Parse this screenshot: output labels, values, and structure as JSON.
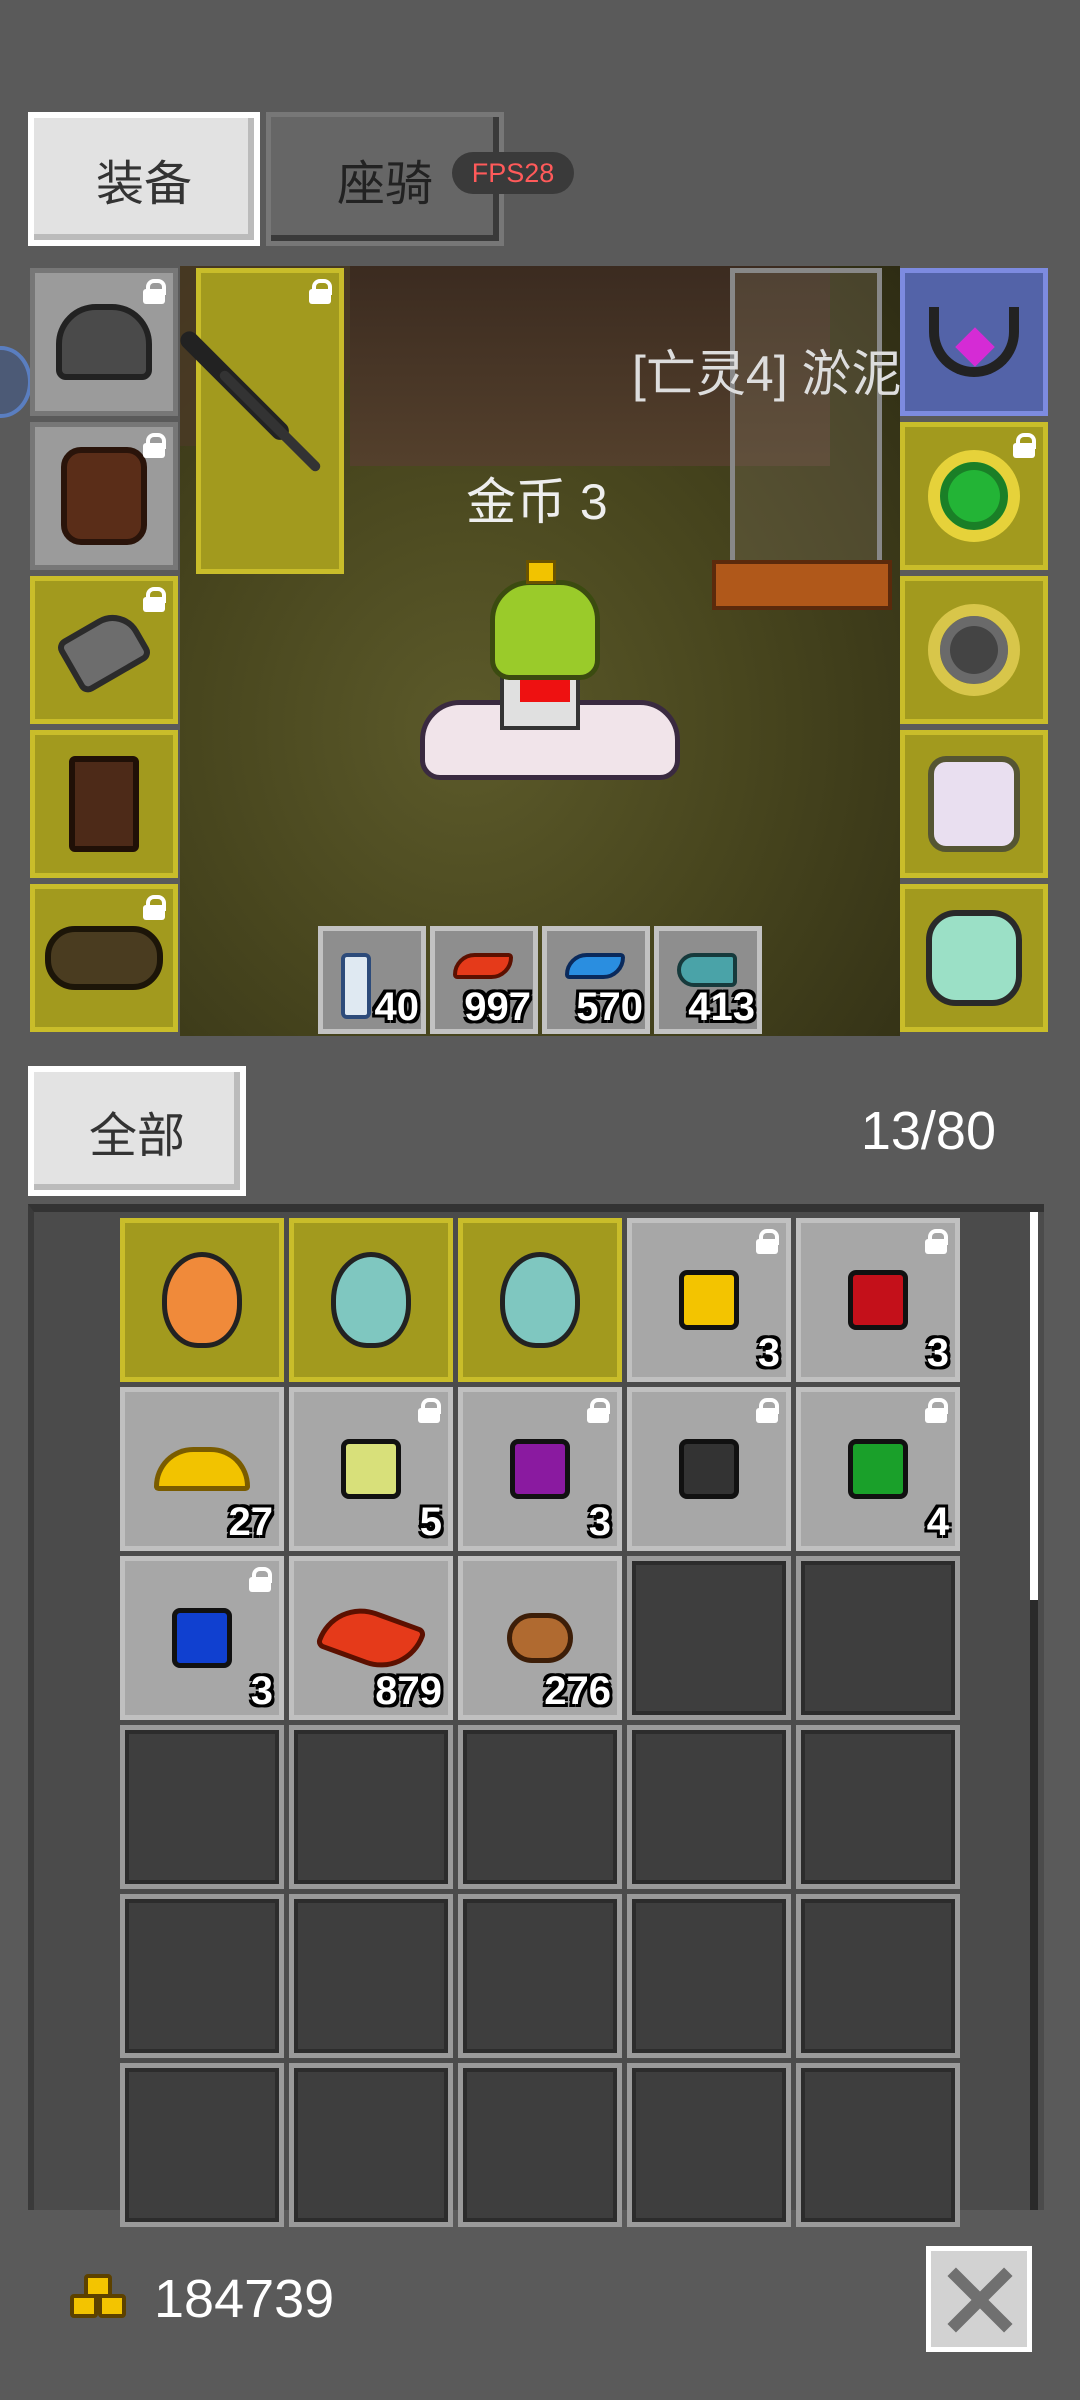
{
  "tabs": {
    "equipment": "装备",
    "mount": "座骑"
  },
  "fps": "FPS28",
  "scene": {
    "gold_text": "金币 3",
    "npc_name": "[亡灵4] 淤泥"
  },
  "equipment_slots": [
    {
      "name": "helmet",
      "locked": true
    },
    {
      "name": "armor",
      "locked": true
    },
    {
      "name": "gloves",
      "locked": true
    },
    {
      "name": "boots",
      "locked": false
    },
    {
      "name": "belt",
      "locked": true
    },
    {
      "name": "spear",
      "locked": true
    },
    {
      "name": "necklace",
      "locked": false
    },
    {
      "name": "green-ring",
      "locked": true
    },
    {
      "name": "black-ring",
      "locked": false
    },
    {
      "name": "unicorn-pet",
      "locked": false
    },
    {
      "name": "green-pet",
      "locked": false
    }
  ],
  "quickbar": [
    {
      "icon": "scroll-icon",
      "count": "40"
    },
    {
      "icon": "red-feather-icon",
      "count": "997"
    },
    {
      "icon": "blue-feather-icon",
      "count": "570"
    },
    {
      "icon": "fish-icon",
      "count": "413"
    }
  ],
  "filter_label": "全部",
  "capacity": "13/80",
  "inventory": [
    {
      "item": "orange-egg",
      "count": "",
      "locked": false,
      "color": "#f08a3a"
    },
    {
      "item": "teal-egg",
      "count": "",
      "locked": false,
      "color": "#7fc7c0"
    },
    {
      "item": "teal-egg",
      "count": "",
      "locked": false,
      "color": "#7fc7c0"
    },
    {
      "item": "yellow-gem",
      "count": "3",
      "locked": true,
      "color": "#f3c400"
    },
    {
      "item": "red-gem",
      "count": "3",
      "locked": true,
      "color": "#c4101a"
    },
    {
      "item": "gold-pile",
      "count": "27",
      "locked": false,
      "color": "#f2c300"
    },
    {
      "item": "pale-green-gem",
      "count": "5",
      "locked": true,
      "color": "#d8e07a"
    },
    {
      "item": "purple-gem",
      "count": "3",
      "locked": true,
      "color": "#8a1aa0"
    },
    {
      "item": "black-gem",
      "count": "",
      "locked": true,
      "color": "#333333"
    },
    {
      "item": "green-gem",
      "count": "4",
      "locked": true,
      "color": "#1aa02a"
    },
    {
      "item": "blue-gem",
      "count": "3",
      "locked": true,
      "color": "#1040d0"
    },
    {
      "item": "red-feather",
      "count": "879",
      "locked": false,
      "color": "#e53a1a"
    },
    {
      "item": "seed",
      "count": "276",
      "locked": false,
      "color": "#b06a30"
    }
  ],
  "gold_amount": "184739"
}
